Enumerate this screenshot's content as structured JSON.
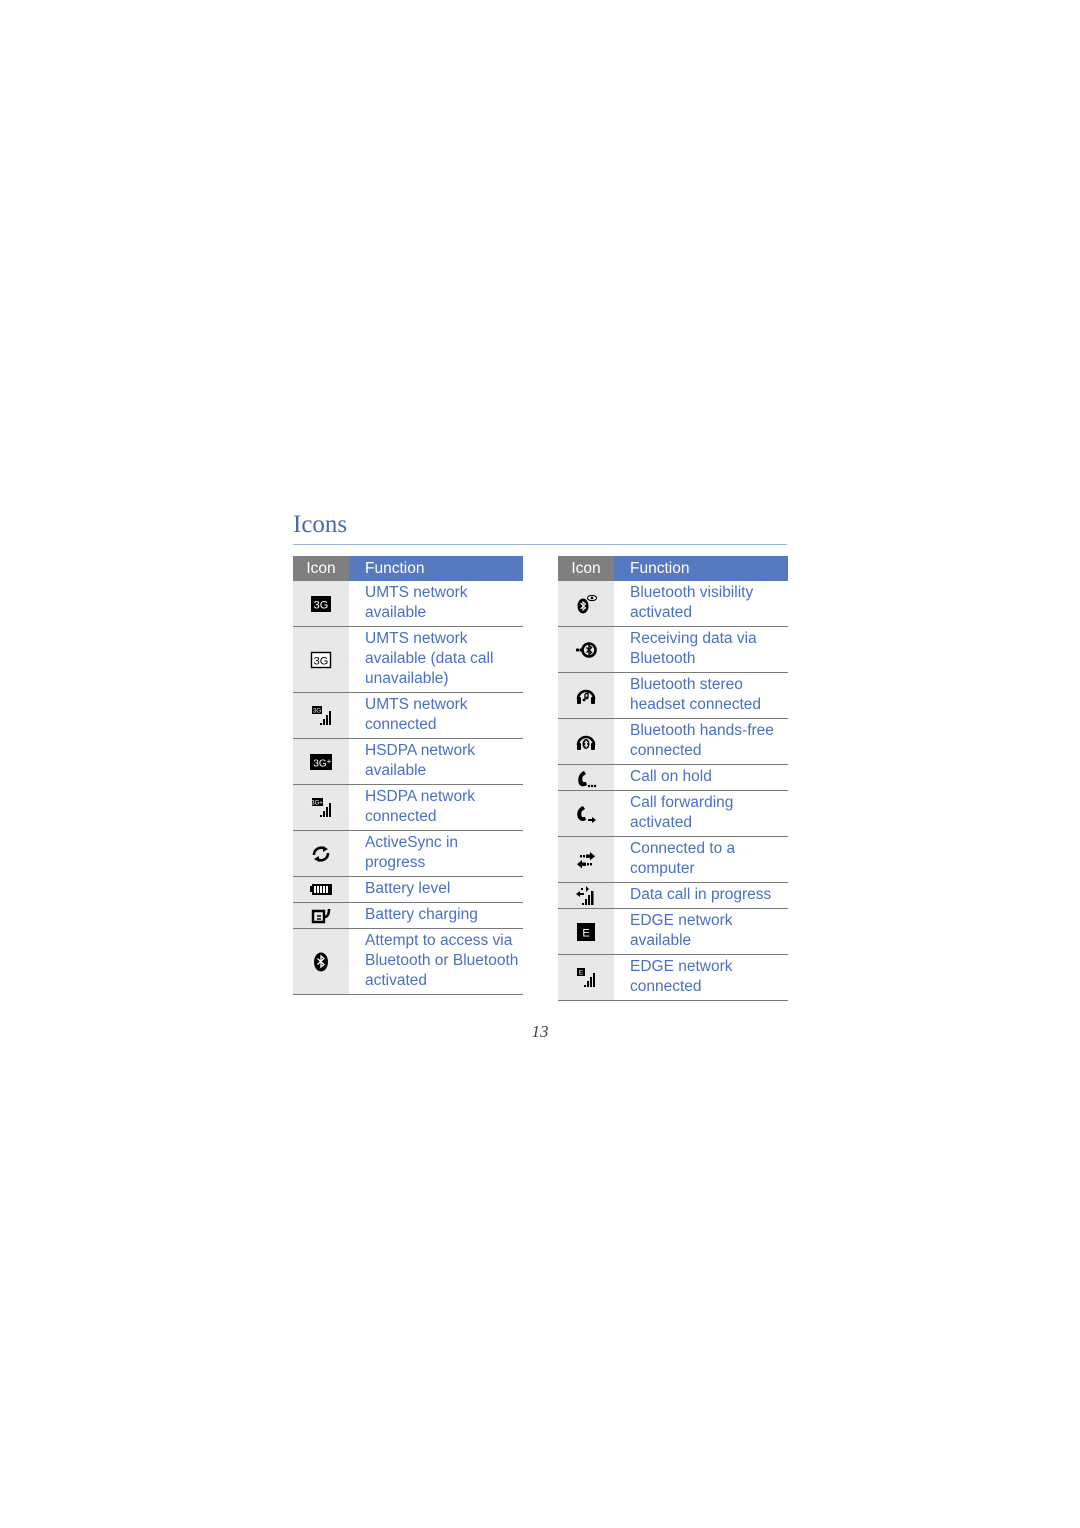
{
  "section_title": "Icons",
  "page_number": "13",
  "colors": {
    "title": "#4a68b4",
    "header_icon_bg": "#7f7f7f",
    "header_function_bg": "#5679bf",
    "function_text": "#4a6fc3",
    "icon_cell_bg": "#e8e8e8"
  },
  "left_table": {
    "headers": {
      "icon": "Icon",
      "function": "Function"
    },
    "rows": [
      {
        "icon": "3g-filled-icon",
        "function": "UMTS network available"
      },
      {
        "icon": "3g-outline-icon",
        "function": "UMTS network available (data call unavailable)"
      },
      {
        "icon": "3g-signal-icon",
        "function": "UMTS network connected"
      },
      {
        "icon": "3g-plus-filled-icon",
        "function": "HSDPA network available"
      },
      {
        "icon": "3g-plus-signal-icon",
        "function": "HSDPA network connected"
      },
      {
        "icon": "activesync-icon",
        "function": "ActiveSync in progress"
      },
      {
        "icon": "battery-level-icon",
        "function": "Battery level"
      },
      {
        "icon": "battery-charging-icon",
        "function": "Battery charging"
      },
      {
        "icon": "bluetooth-icon",
        "function": "Attempt to access via Bluetooth or Bluetooth activated"
      }
    ]
  },
  "right_table": {
    "headers": {
      "icon": "Icon",
      "function": "Function"
    },
    "rows": [
      {
        "icon": "bluetooth-visibility-icon",
        "function": "Bluetooth visibility activated"
      },
      {
        "icon": "bluetooth-receive-icon",
        "function": "Receiving data via Bluetooth"
      },
      {
        "icon": "stereo-headset-icon",
        "function": "Bluetooth stereo headset connected"
      },
      {
        "icon": "handsfree-headset-icon",
        "function": "Bluetooth hands-free connected"
      },
      {
        "icon": "call-hold-icon",
        "function": "Call on hold"
      },
      {
        "icon": "call-forward-icon",
        "function": "Call forwarding activated"
      },
      {
        "icon": "computer-connection-icon",
        "function": "Connected to a computer"
      },
      {
        "icon": "data-call-icon",
        "function": "Data call in progress"
      },
      {
        "icon": "edge-filled-icon",
        "function": "EDGE network available"
      },
      {
        "icon": "edge-signal-icon",
        "function": "EDGE network connected"
      }
    ]
  }
}
